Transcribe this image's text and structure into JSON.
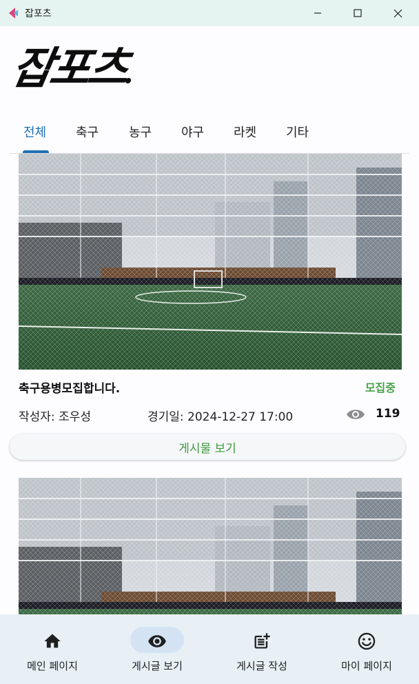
{
  "window": {
    "title": "잡포츠"
  },
  "logo": {
    "text": "잡포츠"
  },
  "tabs": [
    {
      "label": "전체",
      "active": true
    },
    {
      "label": "축구",
      "active": false
    },
    {
      "label": "농구",
      "active": false
    },
    {
      "label": "야구",
      "active": false
    },
    {
      "label": "라켓",
      "active": false
    },
    {
      "label": "기타",
      "active": false
    }
  ],
  "posts": [
    {
      "title": "축구용병모집합니다.",
      "status": "모집중",
      "author": "작성자: 조우성",
      "match_date": "경기일: 2024-12-27 17:00",
      "views": "119",
      "button": "게시물 보기"
    }
  ],
  "nav": {
    "items": [
      {
        "label": "메인 페이지",
        "icon": "home-icon",
        "active": false
      },
      {
        "label": "게시글 보기",
        "icon": "eye-icon",
        "active": true
      },
      {
        "label": "게시글 작성",
        "icon": "post-add-icon",
        "active": false
      },
      {
        "label": "마이 페이지",
        "icon": "smiley-icon",
        "active": false
      }
    ]
  },
  "colors": {
    "accent": "#1e6fb3",
    "status": "#4aa14a",
    "nav_bg": "#e8f0f5",
    "titlebar_bg": "#e6f4f1"
  }
}
